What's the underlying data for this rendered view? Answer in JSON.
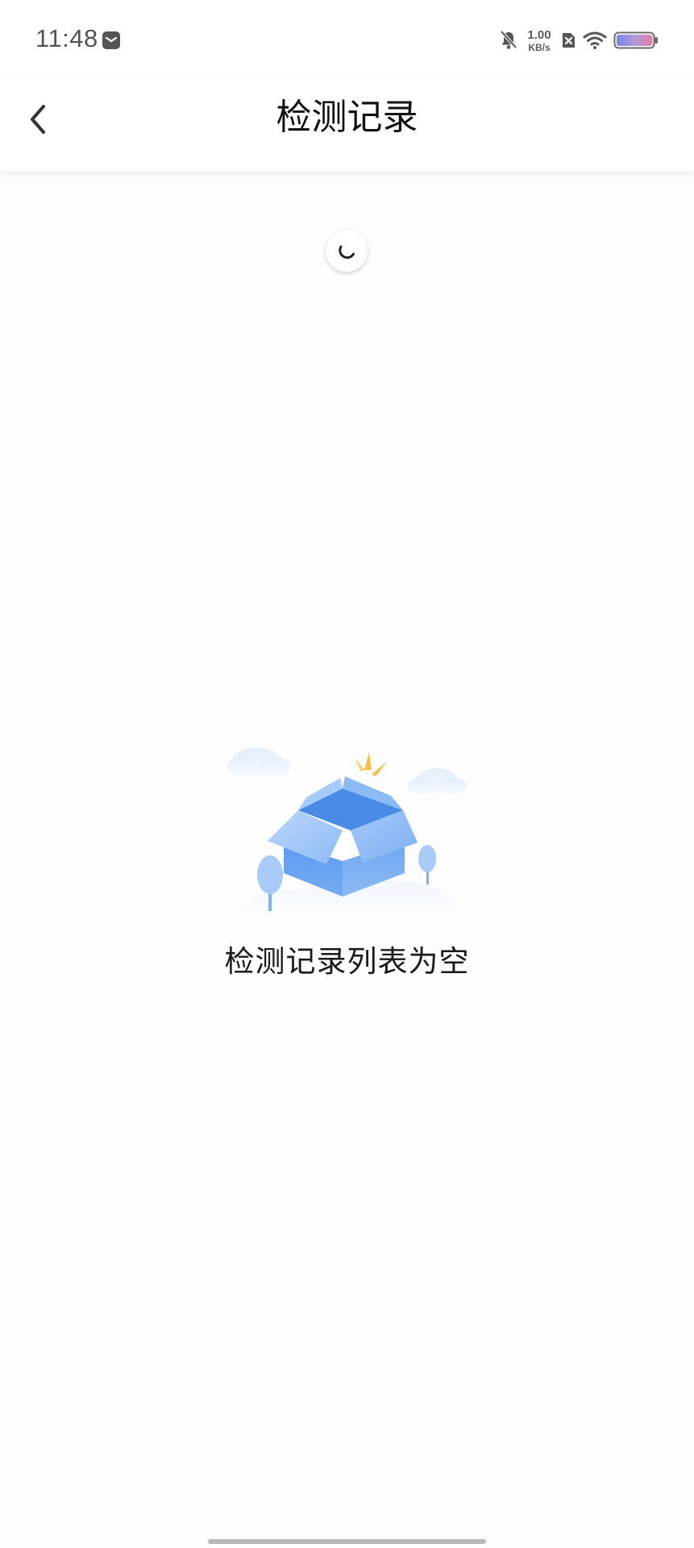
{
  "status_bar": {
    "time": "11:48",
    "net_speed_value": "1.00",
    "net_speed_unit": "KB/s",
    "icons": [
      "mail-icon",
      "bell-off-icon",
      "sim-x-icon",
      "wifi-icon",
      "battery-icon"
    ]
  },
  "header": {
    "back_icon": "chevron-left-icon",
    "title": "检测记录"
  },
  "loading": {
    "icon": "spinner-icon"
  },
  "empty_state": {
    "illustration": "open-box-illustration",
    "message": "检测记录列表为空"
  },
  "colors": {
    "accent_blue": "#5b9ff0",
    "text_primary": "#111111",
    "background": "#fdfdfd"
  }
}
